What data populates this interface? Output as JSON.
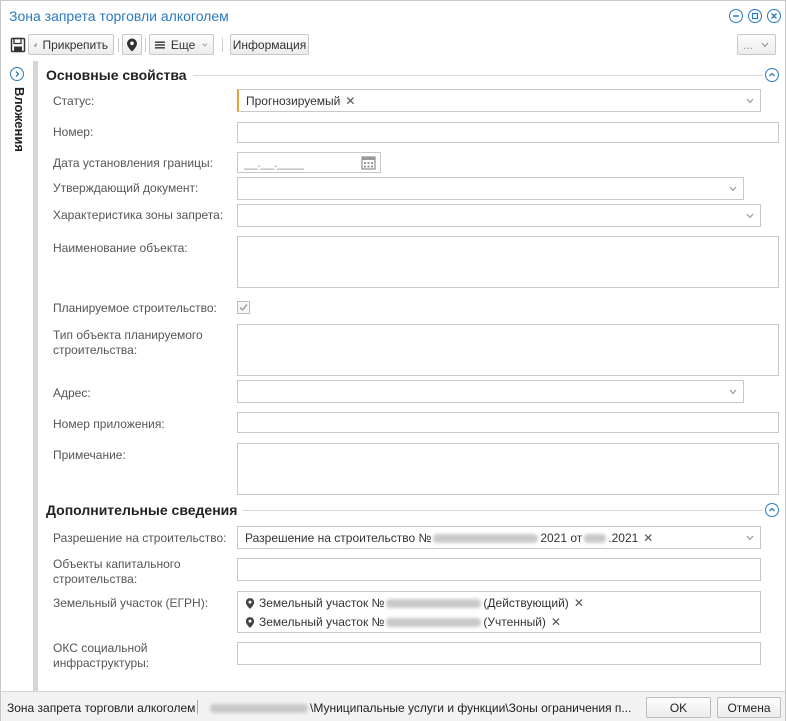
{
  "window": {
    "title": "Зона запрета торговли алкоголем"
  },
  "toolbar": {
    "attach_label": "Прикрепить",
    "more_label": "Еще",
    "info_label": "Информация",
    "overflow_label": "..."
  },
  "sidepanel": {
    "label": "Вложения"
  },
  "sections": {
    "main_title": "Основные свойства",
    "extra_title": "Дополнительные сведения"
  },
  "fields": {
    "status_label": "Статус:",
    "status_value": "Прогнозируемый",
    "number_label": "Номер:",
    "boundary_date_label": "Дата установления границы:",
    "boundary_date_placeholder": "__.__.____",
    "approving_doc_label": "Утверждающий документ:",
    "zone_char_label": "Характеристика зоны запрета:",
    "object_name_label": "Наименование объекта:",
    "planned_construction_label": "Планируемое строительство:",
    "planned_construction_checked": true,
    "planned_object_type_label": "Тип объекта планируемого строительства:",
    "address_label": "Адрес:",
    "appendix_number_label": "Номер приложения:",
    "note_label": "Примечание:",
    "build_permit_label": "Разрешение на строительство:",
    "build_permit_value_prefix": "Разрешение на строительство №",
    "build_permit_value_mid": "2021 от",
    "build_permit_value_suffix": ".2021",
    "capital_objects_label": "Объекты капитального строительства:",
    "land_plot_label": "Земельный участок (ЕГРН):",
    "land_plot_items": [
      {
        "prefix": "Земельный участок №",
        "suffix": "(Действующий)"
      },
      {
        "prefix": "Земельный участок №",
        "suffix": "(Учтенный)"
      }
    ],
    "social_infra_label": "ОКС социальной инфраструктуры:"
  },
  "statusbar": {
    "object_name": "Зона запрета торговли алкоголем",
    "path": "\\Муниципальные услуги и функции\\Зоны ограничения п...",
    "ok_label": "OK",
    "cancel_label": "Отмена"
  },
  "colors": {
    "accent": "#2a7ac0",
    "required_marker": "#e7a23a"
  }
}
